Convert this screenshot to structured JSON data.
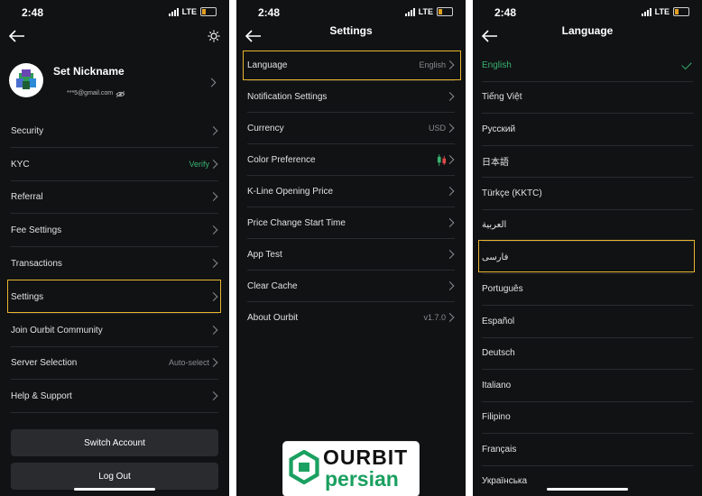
{
  "status": {
    "time": "2:48",
    "network": "LTE"
  },
  "profile": {
    "nickname": "Set Nickname",
    "email": "***5@gmail.com",
    "menu": [
      {
        "label": "Security",
        "value": ""
      },
      {
        "label": "KYC",
        "value": "Verify"
      },
      {
        "label": "Referral",
        "value": ""
      },
      {
        "label": "Fee Settings",
        "value": ""
      },
      {
        "label": "Transactions",
        "value": ""
      },
      {
        "label": "Settings",
        "value": ""
      },
      {
        "label": "Join Ourbit Community",
        "value": ""
      },
      {
        "label": "Server Selection",
        "value": "Auto-select"
      },
      {
        "label": "Help & Support",
        "value": ""
      }
    ],
    "switch_account": "Switch Account",
    "log_out": "Log Out"
  },
  "settings": {
    "title": "Settings",
    "items": [
      {
        "label": "Language",
        "value": "English"
      },
      {
        "label": "Notification Settings",
        "value": ""
      },
      {
        "label": "Currency",
        "value": "USD"
      },
      {
        "label": "Color Preference",
        "value": ""
      },
      {
        "label": "K-Line Opening Price",
        "value": ""
      },
      {
        "label": "Price Change Start Time",
        "value": ""
      },
      {
        "label": "App Test",
        "value": ""
      },
      {
        "label": "Clear Cache",
        "value": ""
      },
      {
        "label": "About Ourbit",
        "value": "v1.7.0"
      }
    ]
  },
  "language": {
    "title": "Language",
    "options": [
      "English",
      "Tiếng Việt",
      "Русский",
      "日本語",
      "Türkçe (KKTC)",
      "العربية",
      "فارسی",
      "Português",
      "Español",
      "Deutsch",
      "Italiano",
      "Filipino",
      "Français",
      "Українська"
    ],
    "selected": "English"
  },
  "logo": {
    "line1": "OURBIT",
    "line2": "persian"
  },
  "colors": {
    "accent": "#38b270",
    "highlight": "#e8b62c",
    "background": "#111214",
    "up": "#38b270",
    "down": "#e04848"
  }
}
